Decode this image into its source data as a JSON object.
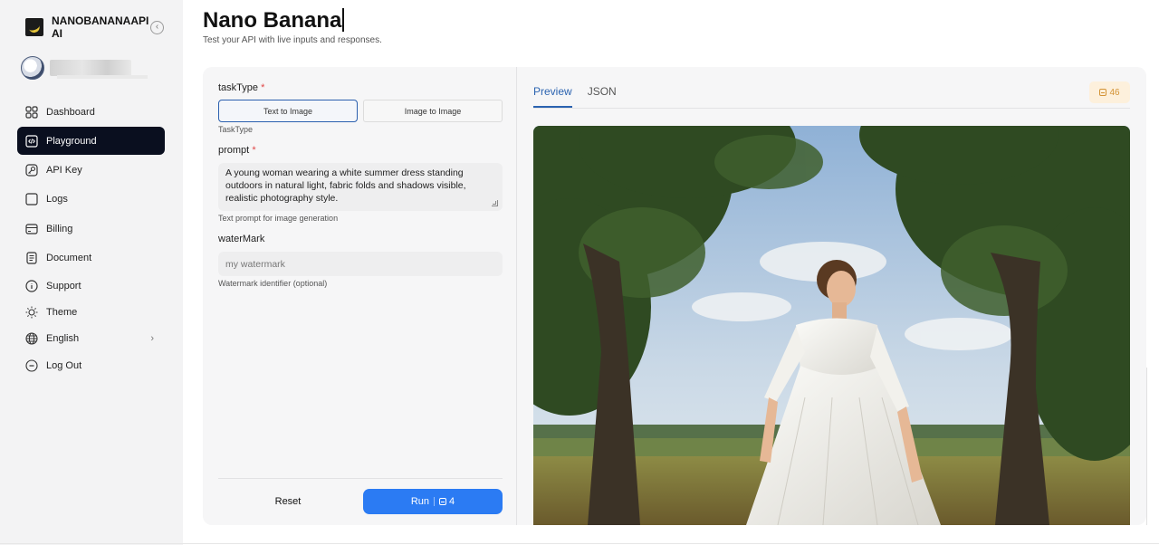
{
  "brand": {
    "name": "NANOBANANAAPI AI"
  },
  "sidebar": {
    "items": [
      {
        "label": "Dashboard",
        "icon": "dashboard-grid-icon"
      },
      {
        "label": "Playground",
        "icon": "code-icon",
        "active": true
      },
      {
        "label": "API Key",
        "icon": "key-icon"
      },
      {
        "label": "Logs",
        "icon": "logs-icon"
      },
      {
        "label": "Billing",
        "icon": "credit-card-icon"
      },
      {
        "label": "Document",
        "icon": "document-icon"
      },
      {
        "label": "Support",
        "icon": "info-icon"
      },
      {
        "label": "Theme",
        "icon": "sun-icon"
      },
      {
        "label": "English",
        "icon": "globe-icon"
      },
      {
        "label": "Log Out",
        "icon": "logout-icon"
      }
    ]
  },
  "page": {
    "title": "Nano Banana",
    "subtitle": "Test your API with live inputs and responses."
  },
  "form": {
    "taskType": {
      "label": "taskType",
      "required_mark": "*",
      "options": [
        "Text to Image",
        "Image to Image"
      ],
      "selected": "Text to Image",
      "hint": "TaskType"
    },
    "prompt": {
      "label": "prompt",
      "required_mark": "*",
      "value": "A young woman wearing a white summer dress standing outdoors in natural light, fabric folds and shadows visible, realistic photography style.",
      "hint": "Text prompt for image generation"
    },
    "waterMark": {
      "label": "waterMark",
      "placeholder": "my watermark",
      "hint": "Watermark identifier (optional)"
    },
    "reset_label": "Reset",
    "run_label": "Run",
    "run_cost": "4"
  },
  "output": {
    "tabs": [
      "Preview",
      "JSON"
    ],
    "active_tab": "Preview",
    "credits": "46"
  },
  "colors": {
    "accent": "#2b7bf3",
    "nav_active": "#0a0f1f",
    "badge_bg": "#fdf0dc",
    "badge_text": "#d39336",
    "required": "#e04646"
  }
}
